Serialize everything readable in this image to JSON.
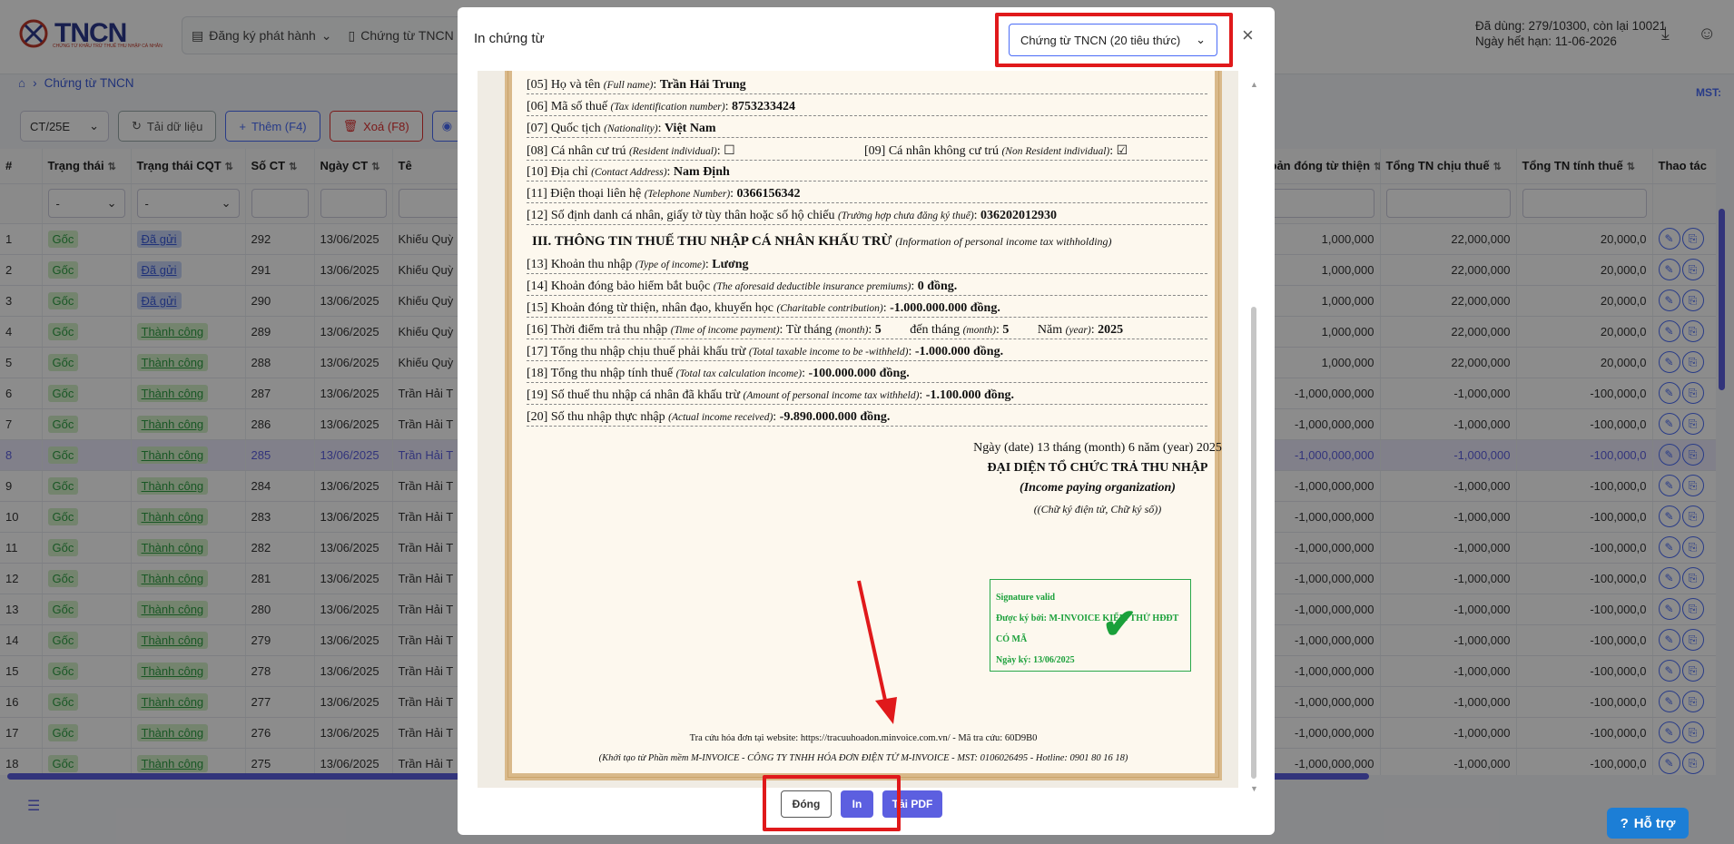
{
  "header": {
    "logo_text": "TNCN",
    "logo_subtitle": "CHỨNG TỪ KHẤU TRỪ THUẾ THU NHẬP CÁ NHÂN",
    "nav": [
      "Đăng ký phát hành",
      "Chứng từ TNCN"
    ],
    "usage": "Đã dùng: 279/10300, còn lại 10021",
    "expiry": "Ngày hết hạn: 11-06-2026"
  },
  "breadcrumb": {
    "label": "Chứng từ TNCN"
  },
  "mst_label": "MST:",
  "toolbar": {
    "series": "CT/25E",
    "reload": "Tải dữ liệu",
    "add": "Thêm (F4)",
    "delete": "Xoá (F8)"
  },
  "table": {
    "headers": [
      "#",
      "Trạng thái",
      "Trạng thái CQT",
      "Số CT",
      "Ngày CT",
      "Tê",
      "oản đóng từ thiện",
      "Tổng TN chịu thuế",
      "Tổng TN tính thuế",
      "Thao tác"
    ],
    "filter_dash": "-",
    "rows": [
      {
        "n": "1",
        "st": "Gốc",
        "cqt": "Đã gửi",
        "so": "292",
        "ngay": "13/06/2025",
        "ten": "Khiếu Quỳ",
        "c1": "1,000,000",
        "c2": "22,000,000",
        "c3": "20,000,0"
      },
      {
        "n": "2",
        "st": "Gốc",
        "cqt": "Đã gửi",
        "so": "291",
        "ngay": "13/06/2025",
        "ten": "Khiếu Quỳ",
        "c1": "1,000,000",
        "c2": "22,000,000",
        "c3": "20,000,0"
      },
      {
        "n": "3",
        "st": "Gốc",
        "cqt": "Đã gửi",
        "so": "290",
        "ngay": "13/06/2025",
        "ten": "Khiếu Quỳ",
        "c1": "1,000,000",
        "c2": "22,000,000",
        "c3": "20,000,0"
      },
      {
        "n": "4",
        "st": "Gốc",
        "cqt": "Thành công",
        "so": "289",
        "ngay": "13/06/2025",
        "ten": "Khiếu Quỳ",
        "c1": "1,000,000",
        "c2": "22,000,000",
        "c3": "20,000,0"
      },
      {
        "n": "5",
        "st": "Gốc",
        "cqt": "Thành công",
        "so": "288",
        "ngay": "13/06/2025",
        "ten": "Khiếu Quỳ",
        "c1": "1,000,000",
        "c2": "22,000,000",
        "c3": "20,000,0"
      },
      {
        "n": "6",
        "st": "Gốc",
        "cqt": "Thành công",
        "so": "287",
        "ngay": "13/06/2025",
        "ten": "Trần Hải T",
        "c1": "-1,000,000,000",
        "c2": "-1,000,000",
        "c3": "-100,000,0"
      },
      {
        "n": "7",
        "st": "Gốc",
        "cqt": "Thành công",
        "so": "286",
        "ngay": "13/06/2025",
        "ten": "Trần Hải T",
        "c1": "-1,000,000,000",
        "c2": "-1,000,000",
        "c3": "-100,000,0"
      },
      {
        "n": "8",
        "st": "Gốc",
        "cqt": "Thành công",
        "so": "285",
        "ngay": "13/06/2025",
        "ten": "Trần Hải T",
        "c1": "-1,000,000,000",
        "c2": "-1,000,000",
        "c3": "-100,000,0"
      },
      {
        "n": "9",
        "st": "Gốc",
        "cqt": "Thành công",
        "so": "284",
        "ngay": "13/06/2025",
        "ten": "Trần Hải T",
        "c1": "-1,000,000,000",
        "c2": "-1,000,000",
        "c3": "-100,000,0"
      },
      {
        "n": "10",
        "st": "Gốc",
        "cqt": "Thành công",
        "so": "283",
        "ngay": "13/06/2025",
        "ten": "Trần Hải T",
        "c1": "-1,000,000,000",
        "c2": "-1,000,000",
        "c3": "-100,000,0"
      },
      {
        "n": "11",
        "st": "Gốc",
        "cqt": "Thành công",
        "so": "282",
        "ngay": "13/06/2025",
        "ten": "Trần Hải T",
        "c1": "-1,000,000,000",
        "c2": "-1,000,000",
        "c3": "-100,000,0"
      },
      {
        "n": "12",
        "st": "Gốc",
        "cqt": "Thành công",
        "so": "281",
        "ngay": "13/06/2025",
        "ten": "Trần Hải T",
        "c1": "-1,000,000,000",
        "c2": "-1,000,000",
        "c3": "-100,000,0"
      },
      {
        "n": "13",
        "st": "Gốc",
        "cqt": "Thành công",
        "so": "280",
        "ngay": "13/06/2025",
        "ten": "Trần Hải T",
        "c1": "-1,000,000,000",
        "c2": "-1,000,000",
        "c3": "-100,000,0"
      },
      {
        "n": "14",
        "st": "Gốc",
        "cqt": "Thành công",
        "so": "279",
        "ngay": "13/06/2025",
        "ten": "Trần Hải T",
        "c1": "-1,000,000,000",
        "c2": "-1,000,000",
        "c3": "-100,000,0"
      },
      {
        "n": "15",
        "st": "Gốc",
        "cqt": "Thành công",
        "so": "278",
        "ngay": "13/06/2025",
        "ten": "Trần Hải T",
        "c1": "-1,000,000,000",
        "c2": "-1,000,000",
        "c3": "-100,000,0"
      },
      {
        "n": "16",
        "st": "Gốc",
        "cqt": "Thành công",
        "so": "277",
        "ngay": "13/06/2025",
        "ten": "Trần Hải T",
        "c1": "-1,000,000,000",
        "c2": "-1,000,000",
        "c3": "-100,000,0"
      },
      {
        "n": "17",
        "st": "Gốc",
        "cqt": "Thành công",
        "so": "276",
        "ngay": "13/06/2025",
        "ten": "Trần Hải T",
        "c1": "-1,000,000,000",
        "c2": "-1,000,000",
        "c3": "-100,000,0"
      },
      {
        "n": "18",
        "st": "Gốc",
        "cqt": "Thành công",
        "so": "275",
        "ngay": "13/06/2025",
        "ten": "Trần Hải T",
        "c1": "-1,000,000,000",
        "c2": "-1,000,000",
        "c3": "-100,000,0"
      }
    ]
  },
  "modal": {
    "title": "In chứng từ",
    "template": "Chứng từ TNCN (20 tiêu thức)",
    "buttons": {
      "close": "Đóng",
      "print": "In",
      "pdf": "Tải PDF"
    }
  },
  "doc": {
    "l05": {
      "lbl": "[05] Họ và tên ",
      "en": "(Full name)",
      "val": "Trần Hải Trung"
    },
    "l06": {
      "lbl": "[06] Mã số thuế ",
      "en": "(Tax identification number)",
      "val": "8753233424"
    },
    "l07": {
      "lbl": "[07] Quốc tịch ",
      "en": "(Nationality)",
      "val": "Việt Nam"
    },
    "l08": {
      "lbl": "[08] Cá nhân cư trú ",
      "en": "(Resident individual)",
      "box": "☐"
    },
    "l09": {
      "lbl": "[09] Cá nhân không cư trú ",
      "en": "(Non Resident individual)",
      "box": "☑"
    },
    "l10": {
      "lbl": "[10] Địa chỉ ",
      "en": "(Contact Address)",
      "val": "Nam Định"
    },
    "l11": {
      "lbl": "[11] Điện thoại liên hệ ",
      "en": "(Telephone Number)",
      "val": "0366156342"
    },
    "l12": {
      "lbl": "[12] Số định danh cá nhân, giấy tờ tùy thân hoặc số hộ chiếu ",
      "en": "(Trường hợp chưa đăng ký thuế)",
      "val": "036202012930"
    },
    "sec3": {
      "title": "III. THÔNG TIN THUẾ THU NHẬP CÁ NHÂN KHẤU TRỪ ",
      "en": "(Information of personal income tax withholding)"
    },
    "l13": {
      "lbl": "[13] Khoản thu nhập ",
      "en": "(Type of income)",
      "val": "Lương"
    },
    "l14": {
      "lbl": "[14] Khoản đóng bảo hiểm bắt buộc ",
      "en": "(The aforesaid deductible insurance premiums)",
      "val": "0 đồng."
    },
    "l15": {
      "lbl": "[15] Khoản đóng từ thiện, nhân đạo, khuyến học ",
      "en": "(Charitable contribution)",
      "val": "-1.000.000.000 đồng."
    },
    "l16": {
      "lbl": "[16] Thời điểm trả thu nhập ",
      "en": "(Time of income payment)",
      "from_lbl": "Từ tháng",
      "from_en": "(month)",
      "from_val": "5",
      "to_lbl": "đến tháng",
      "to_en": "(month)",
      "to_val": "5",
      "yr_lbl": "Năm",
      "yr_en": "(year)",
      "yr_val": "2025"
    },
    "l17": {
      "lbl": "[17] Tổng thu nhập chịu thuế phải khấu trừ ",
      "en": "(Total taxable income to be -withheld)",
      "val": "-1.000.000 đồng."
    },
    "l18": {
      "lbl": "[18] Tổng thu nhập tính thuế ",
      "en": "(Total tax calculation income)",
      "val": "-100.000.000 đồng."
    },
    "l19": {
      "lbl": "[19] Số thuế thu nhập cá nhân đã khấu trừ ",
      "en": "(Amount of personal income tax withheld)",
      "val": "-1.100.000 đồng."
    },
    "l20": {
      "lbl": "[20] Số thu nhập thực nhập ",
      "en": "(Actual income received)",
      "val": "-9.890.000.000 đồng."
    },
    "date_line": "Ngày (date) 13 tháng (month) 6 năm (year) 2025",
    "org_title": "ĐẠI DIỆN TỔ CHỨC TRẢ THU NHẬP",
    "org_en": "(Income paying organization)",
    "sig_note": "((Chữ ký điện tử, Chữ ký số))",
    "sig": {
      "l1": "Signature valid",
      "l2": "Được ký bởi: M-INVOICE KIỂM THỬ HĐĐT",
      "l3": "CÓ MÃ",
      "l4": "Ngày ký: 13/06/2025"
    },
    "lookup": "Tra cứu hóa đơn tại website: https://tracuuhoadon.minvoice.com.vn/ - Mã tra cứu: 60D9B0",
    "created": "(Khởi tạo từ Phần mềm M-INVOICE - CÔNG TY TNHH HÓA ĐƠN ĐIỆN TỬ M-INVOICE - MST: 0106026495 - Hotline: 0901 80 16 18)"
  },
  "help": "Hỗ trợ",
  "colors": {
    "accent": "#5c5fe0",
    "annotation": "#e0191b",
    "success": "#2f9e44"
  }
}
